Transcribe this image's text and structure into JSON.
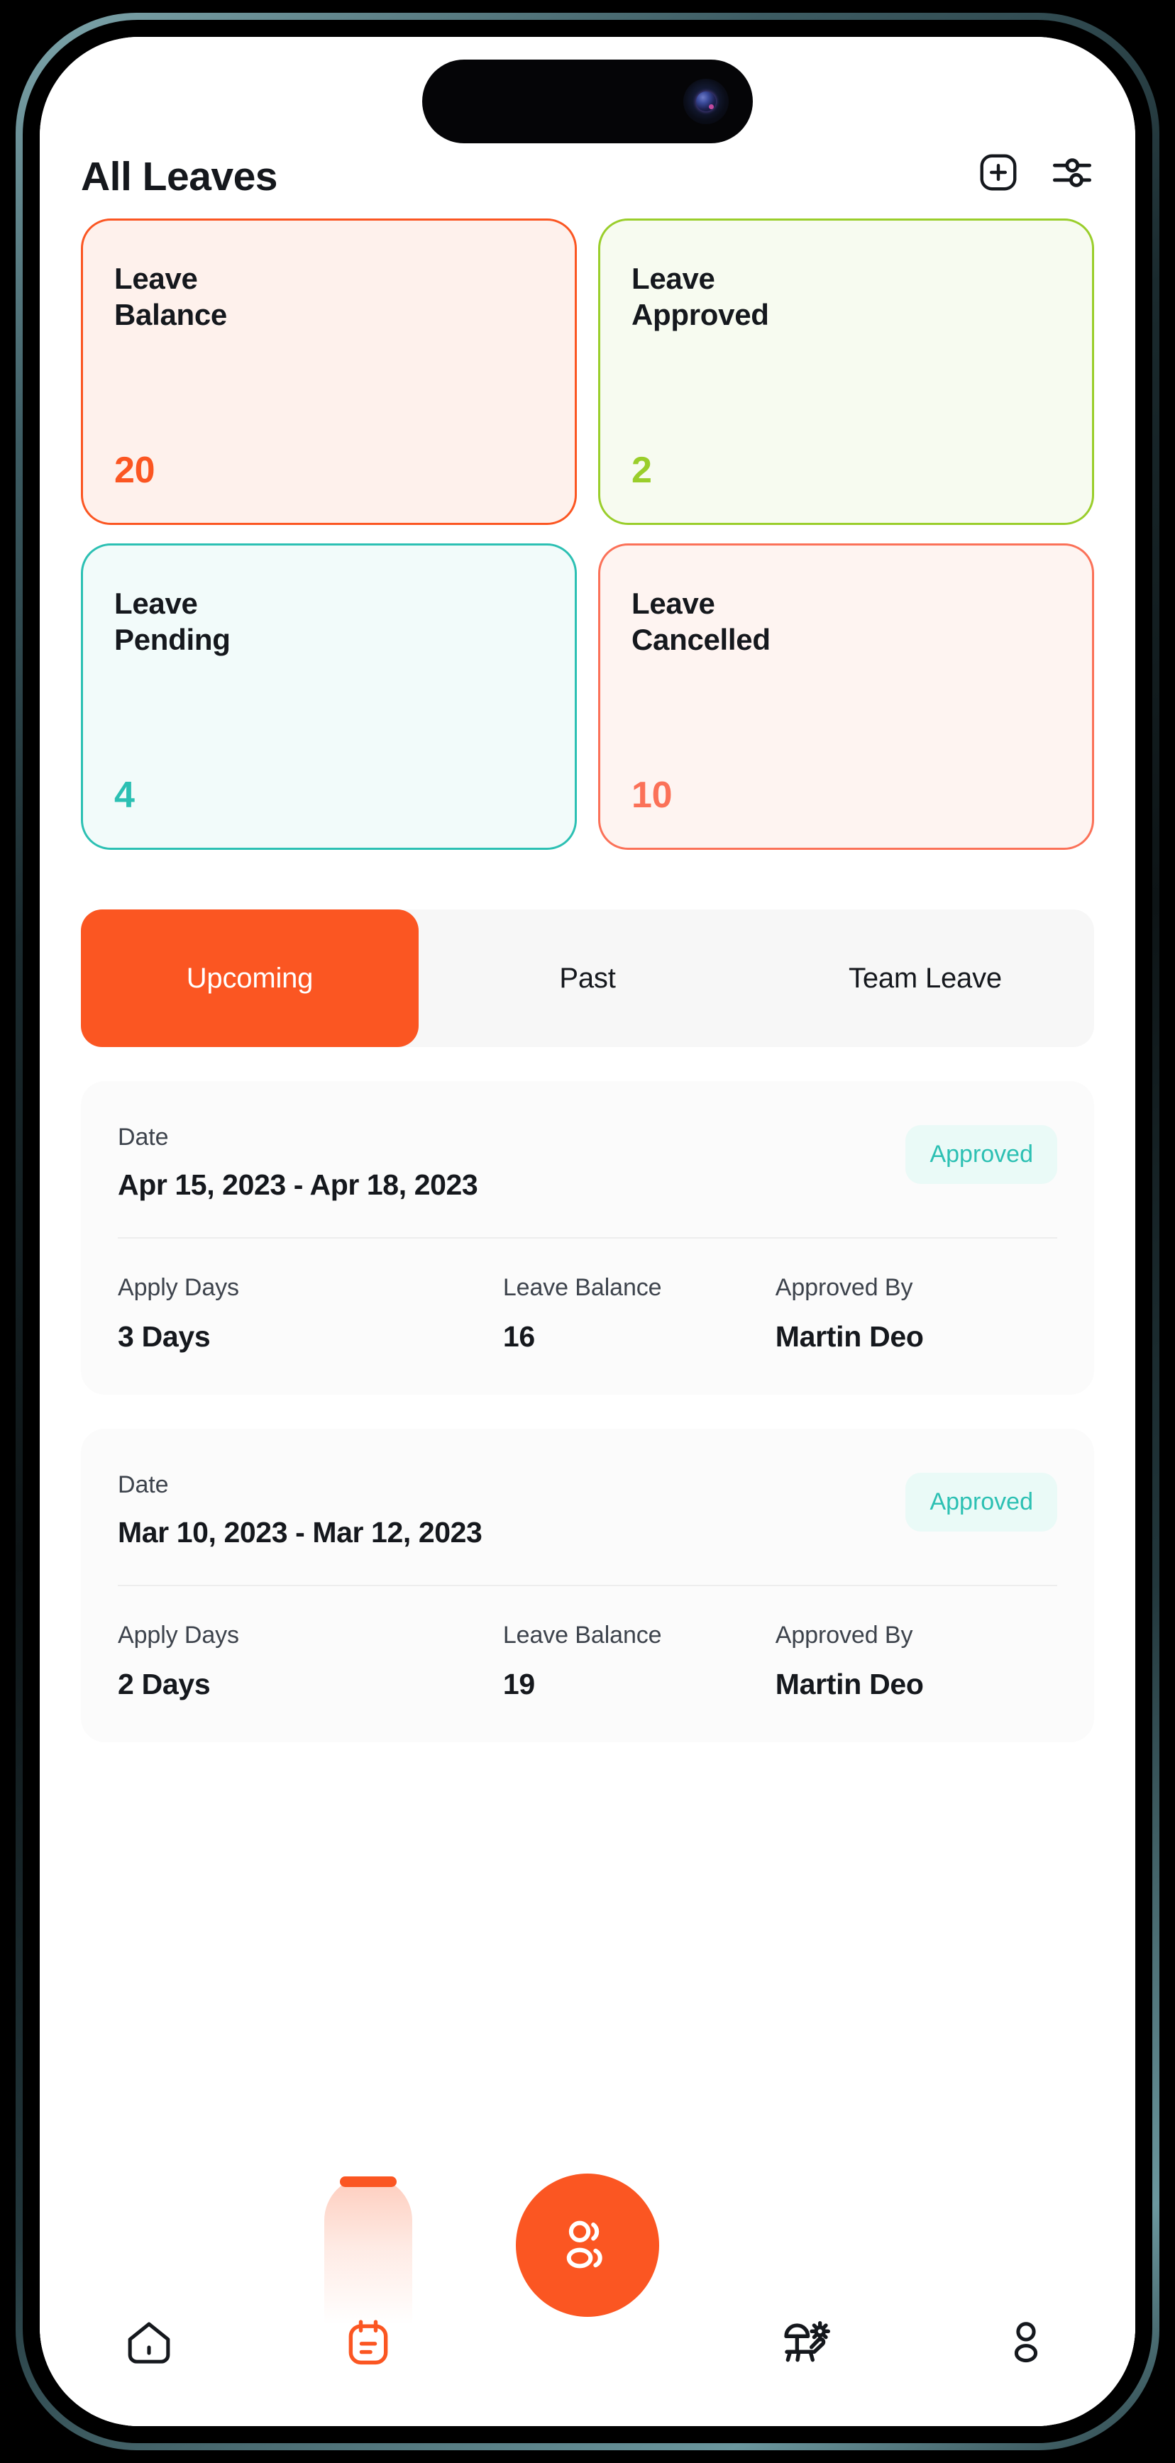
{
  "header": {
    "title": "All Leaves",
    "add_icon": "plus-square-icon",
    "filter_icon": "sliders-filter-icon"
  },
  "stats": [
    {
      "label": "Leave\nBalance",
      "label_line1": "Leave",
      "label_line2": "Balance",
      "value": "20",
      "accent": "#fb5622",
      "bg": "#fef1ec",
      "border": "#fb5622"
    },
    {
      "label": "Leave\nApproved",
      "label_line1": "Leave",
      "label_line2": "Approved",
      "value": "2",
      "accent": "#9ace2b",
      "bg": "#f7fbf0",
      "border": "#9ace2b"
    },
    {
      "label": "Leave\nPending",
      "label_line1": "Leave",
      "label_line2": "Pending",
      "value": "4",
      "accent": "#2cc0b3",
      "bg": "#f2fbfa",
      "border": "#2cc0b3"
    },
    {
      "label": "Leave\nCancelled",
      "label_line1": "Leave",
      "label_line2": "Cancelled",
      "value": "10",
      "accent": "#fb7158",
      "bg": "#fef4f1",
      "border": "#fb7158"
    }
  ],
  "tabs": [
    {
      "label": "Upcoming",
      "active": true
    },
    {
      "label": "Past",
      "active": false
    },
    {
      "label": "Team Leave",
      "active": false
    }
  ],
  "list_field_labels": {
    "date": "Date",
    "apply_days": "Apply Days",
    "leave_balance": "Leave Balance",
    "approved_by": "Approved By"
  },
  "leaves": [
    {
      "date_label": "Date",
      "date_range": "Apr 15, 2023 - Apr 18, 2023",
      "status": "Approved",
      "apply_days_label": "Apply Days",
      "apply_days": "3 Days",
      "leave_balance_label": "Leave Balance",
      "leave_balance": "16",
      "approved_by_label": "Approved By",
      "approved_by": "Martin Deo"
    },
    {
      "date_label": "Date",
      "date_range": "Mar 10, 2023 - Mar 12, 2023",
      "status": "Approved",
      "apply_days_label": "Apply Days",
      "apply_days": "2 Days",
      "leave_balance_label": "Leave Balance",
      "leave_balance": "19",
      "approved_by_label": "Approved By",
      "approved_by": "Martin Deo"
    }
  ],
  "bottom_nav": {
    "items": [
      {
        "icon": "home-icon",
        "active": false
      },
      {
        "icon": "calendar-notes-icon",
        "active": true
      },
      {
        "icon": "beach-holiday-icon",
        "active": false
      },
      {
        "icon": "profile-person-icon",
        "active": false
      }
    ],
    "fab_icon": "people-group-icon",
    "fab_color": "#fb5622"
  },
  "colors": {
    "brand_orange": "#fb5622",
    "green": "#9ace2b",
    "teal": "#2cc0b3",
    "coral": "#fb7158",
    "text_dark": "#15181d",
    "text_muted": "#3d434c",
    "card_bg": "#fbfbfb",
    "tabs_bg": "#f7f7f7"
  }
}
